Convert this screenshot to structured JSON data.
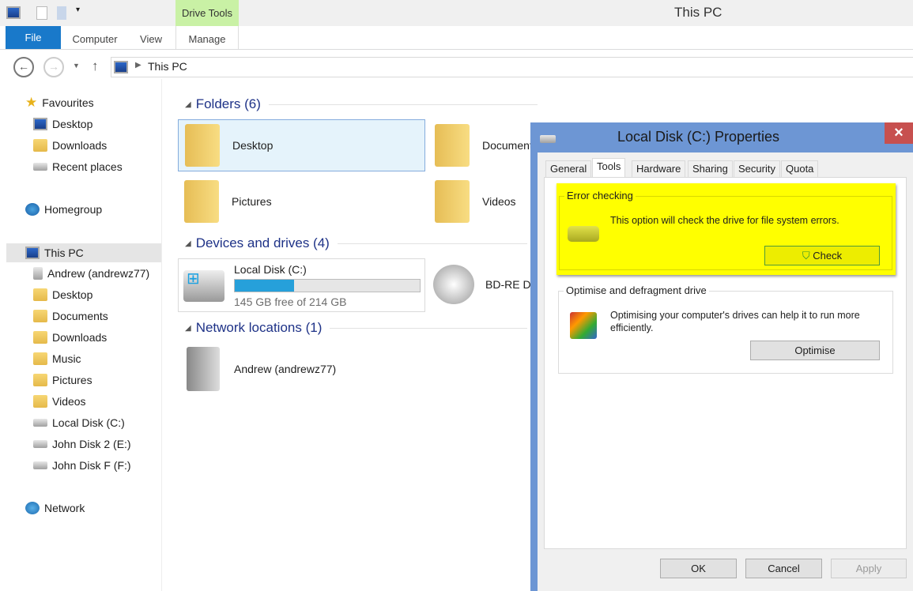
{
  "window": {
    "title": "This PC",
    "context_tab": "Drive Tools"
  },
  "ribbon": {
    "tabs": [
      "File",
      "Computer",
      "View",
      "Manage"
    ]
  },
  "address": {
    "path": "This PC"
  },
  "sidebar": {
    "favourites": {
      "label": "Favourites",
      "items": [
        "Desktop",
        "Downloads",
        "Recent places"
      ]
    },
    "homegroup": "Homegroup",
    "this_pc": {
      "label": "This PC",
      "items": [
        "Andrew (andrewz77)",
        "Desktop",
        "Documents",
        "Downloads",
        "Music",
        "Pictures",
        "Videos",
        "Local Disk (C:)",
        "John Disk 2 (E:)",
        "John Disk F (F:)"
      ]
    },
    "network": "Network"
  },
  "content": {
    "folders_header": "Folders (6)",
    "folders": [
      "Desktop",
      "Documents",
      "Pictures",
      "Videos"
    ],
    "devices_header": "Devices and drives (4)",
    "local_disk": {
      "name": "Local Disk (C:)",
      "free": "145 GB free of 214 GB",
      "used_fraction": 0.32
    },
    "bd_drive": "BD-RE D",
    "network_header": "Network locations (1)",
    "network_item": "Andrew (andrewz77)"
  },
  "dialog": {
    "title": "Local Disk (C:) Properties",
    "close": "×",
    "tabs": [
      "General",
      "Tools",
      "Hardware",
      "Sharing",
      "Security",
      "Quota"
    ],
    "error_checking": {
      "title": "Error checking",
      "text": "This option will check the drive for file system errors.",
      "button": "Check"
    },
    "optimise": {
      "title": "Optimise and defragment drive",
      "text": "Optimising your computer's drives can help it to run more efficiently.",
      "button": "Optimise"
    },
    "buttons": {
      "ok": "OK",
      "cancel": "Cancel",
      "apply": "Apply"
    },
    "highlight_color": "#ffff00"
  }
}
